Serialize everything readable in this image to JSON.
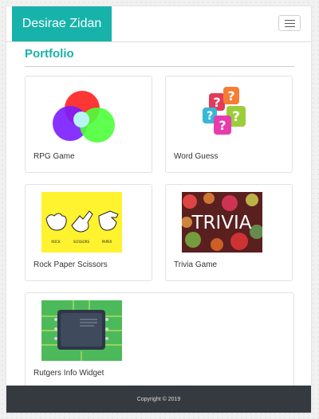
{
  "navbar": {
    "brand": "Desirae Zidan"
  },
  "portfolio": {
    "title": "Portfolio",
    "items": [
      {
        "label": "RPG Game"
      },
      {
        "label": "Word Guess"
      },
      {
        "label": "Rock Paper Scissors",
        "thumb_text": [
          "ROCK",
          "SCISSORS",
          "PAPER"
        ]
      },
      {
        "label": "Trivia Game",
        "thumb_text": "TRIVIA"
      },
      {
        "label": "Rutgers Info Widget"
      }
    ]
  },
  "footer": {
    "copyright": "Copyright © 2019"
  },
  "colors": {
    "accent": "#17b3aa",
    "footer_bg": "#343a40"
  }
}
